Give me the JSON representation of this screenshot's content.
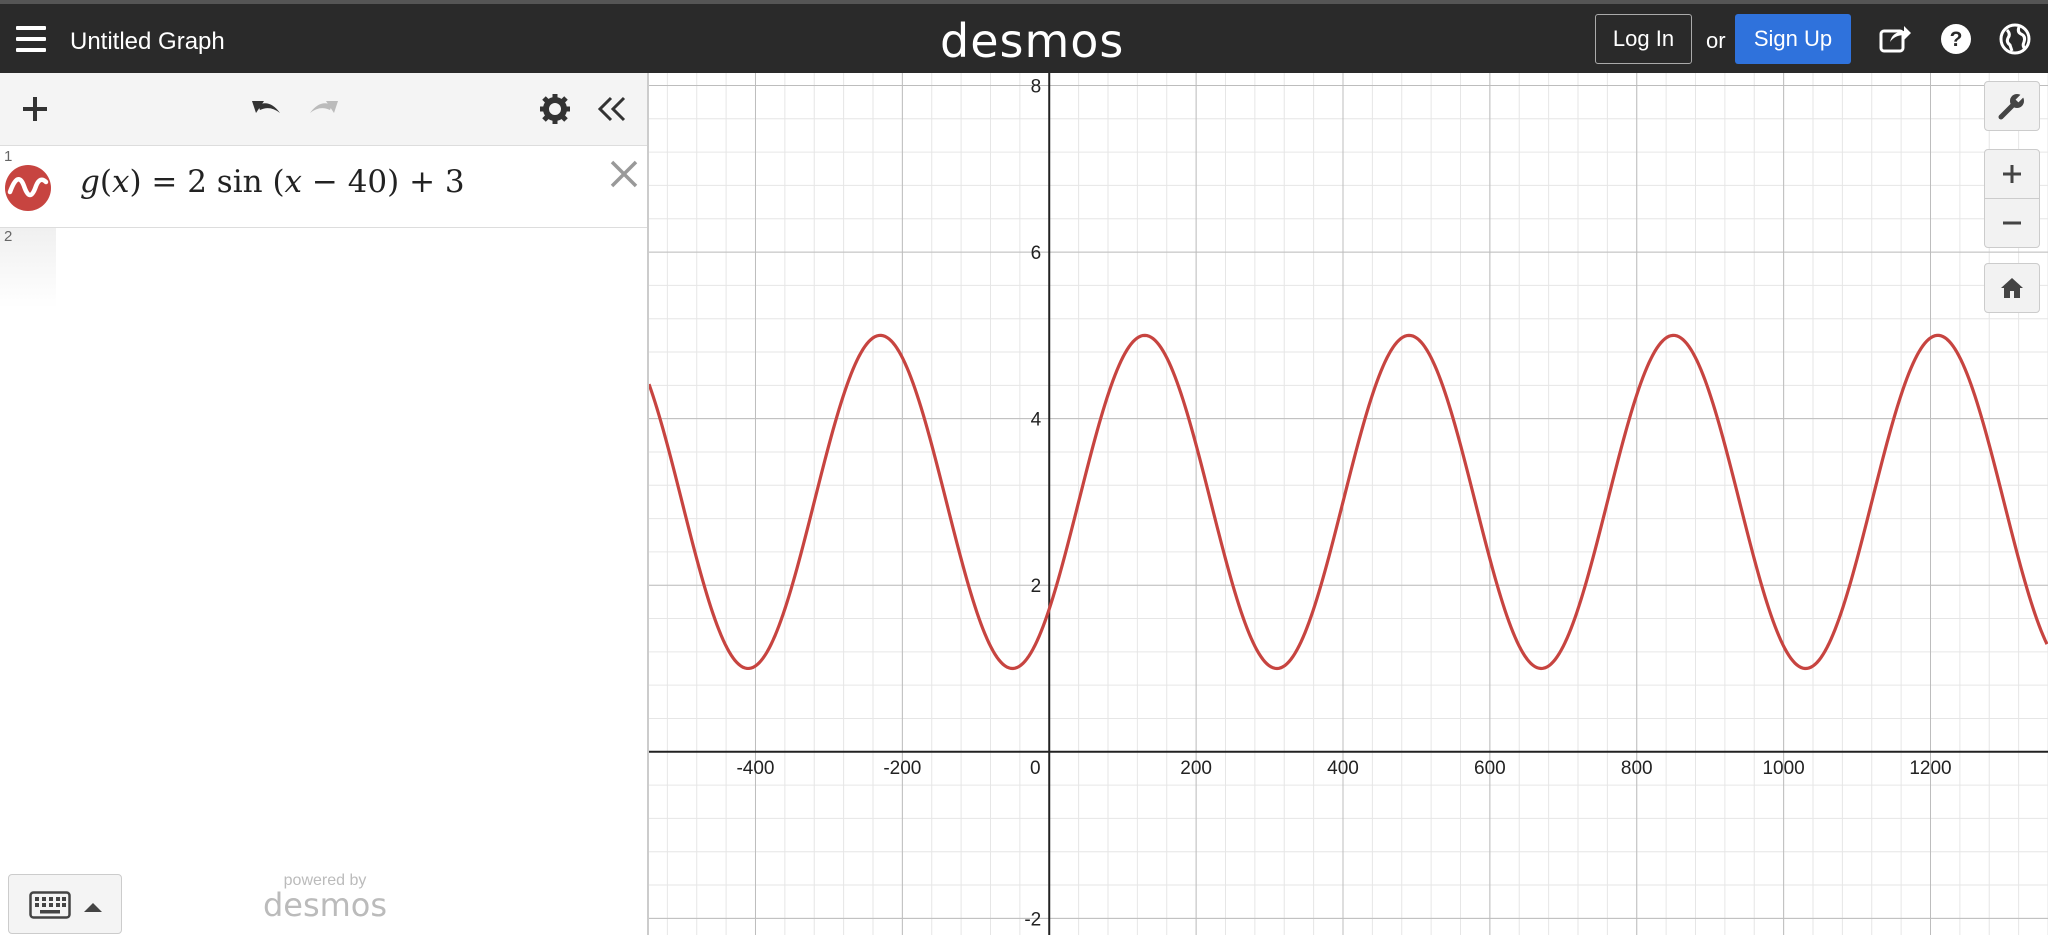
{
  "header": {
    "title": "Untitled Graph",
    "brand": "desmos",
    "login_label": "Log In",
    "or_text": "or",
    "signup_label": "Sign Up",
    "icons": [
      "menu-icon",
      "share-icon",
      "help-icon",
      "globe-icon"
    ],
    "signup_color": "#2f72dc"
  },
  "sidebar": {
    "toolbar_icons": [
      "add-icon",
      "undo-icon",
      "redo-icon",
      "gear-icon",
      "collapse-icon"
    ],
    "expressions": [
      {
        "line": "1",
        "latex_parts": [
          "g",
          "(",
          "x",
          ") = 2 sin (",
          "x",
          " − 40) + 3"
        ],
        "color": "#c74440",
        "icon": "sine-wave-icon"
      },
      {
        "line": "2",
        "latex_parts": []
      }
    ],
    "powered_by": "powered by",
    "powered_brand": "desmos",
    "keyboard_icon": "keyboard-icon"
  },
  "chart_data": {
    "type": "line",
    "function": "g(x) = 2 sin(x − 40) + 3",
    "xlim": [
      -545,
      1360
    ],
    "ylim": [
      -2.2,
      8.15
    ],
    "x_ticks": [
      -400,
      -200,
      0,
      200,
      400,
      600,
      800,
      1000,
      1200
    ],
    "y_ticks": [
      -2,
      2,
      4,
      6,
      8
    ],
    "grid": true,
    "series": [
      {
        "color": "#c74440",
        "amplitude": 2,
        "offset": 3,
        "phase_shift": 40,
        "period": 360
      }
    ]
  },
  "graph_controls": {
    "icons": [
      "wrench-icon",
      "zoom-in-icon",
      "zoom-out-icon",
      "home-icon"
    ]
  }
}
